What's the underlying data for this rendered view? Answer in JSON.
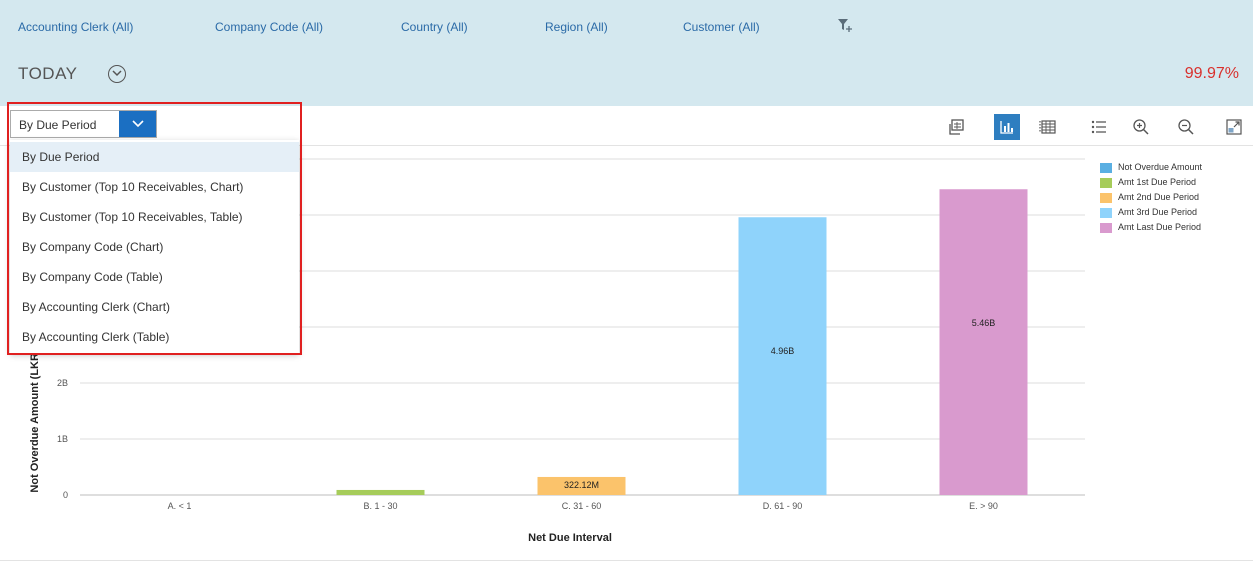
{
  "filters": {
    "accounting_clerk": "Accounting Clerk (All)",
    "company_code": "Company Code (All)",
    "country": "Country (All)",
    "region": "Region (All)",
    "customer": "Customer (All)"
  },
  "header": {
    "period_label": "TODAY",
    "kpi_value": "99.97%"
  },
  "selector": {
    "selected": "By Due Period",
    "options": [
      "By Due Period",
      "By Customer (Top 10 Receivables, Chart)",
      "By Customer (Top 10 Receivables, Table)",
      "By Company Code (Chart)",
      "By Company Code (Table)",
      "By Accounting Clerk (Chart)",
      "By Accounting Clerk (Table)"
    ]
  },
  "colors": {
    "header_bg": "#d4e8ef",
    "accent": "#1b6fc2",
    "kpi": "#d9302c"
  },
  "chart_data": {
    "type": "bar",
    "xlabel": "Net Due Interval",
    "ylabel": "Not Overdue Amount (LKR)",
    "categories": [
      "A. < 1",
      "B. 1 - 30",
      "C. 31 - 60",
      "D. 61 - 90",
      "E. > 90"
    ],
    "values": [
      0.0,
      0.09,
      0.32212,
      4.96,
      5.46
    ],
    "data_labels": [
      "",
      "",
      "322.12M",
      "4.96B",
      "5.46B"
    ],
    "bar_colors": [
      "#5aafe2",
      "#a6cc5a",
      "#fbc36b",
      "#8fd3fb",
      "#d99ace"
    ],
    "y_ticks": [
      {
        "value": 0,
        "label": "0"
      },
      {
        "value": 1,
        "label": "1B"
      },
      {
        "value": 2,
        "label": "2B"
      }
    ],
    "gridlines": [
      0,
      1,
      2,
      3,
      4,
      5,
      6
    ],
    "ylim": [
      0,
      6
    ],
    "legend": [
      {
        "name": "Not Overdue Amount",
        "color": "#5aafe2"
      },
      {
        "name": "Amt 1st Due Period",
        "color": "#a6cc5a"
      },
      {
        "name": "Amt 2nd Due Period",
        "color": "#fbc36b"
      },
      {
        "name": "Amt 3rd Due Period",
        "color": "#8fd3fb"
      },
      {
        "name": "Amt Last Due Period",
        "color": "#d99ace"
      }
    ],
    "legend_position": "top-right",
    "grid": true
  }
}
